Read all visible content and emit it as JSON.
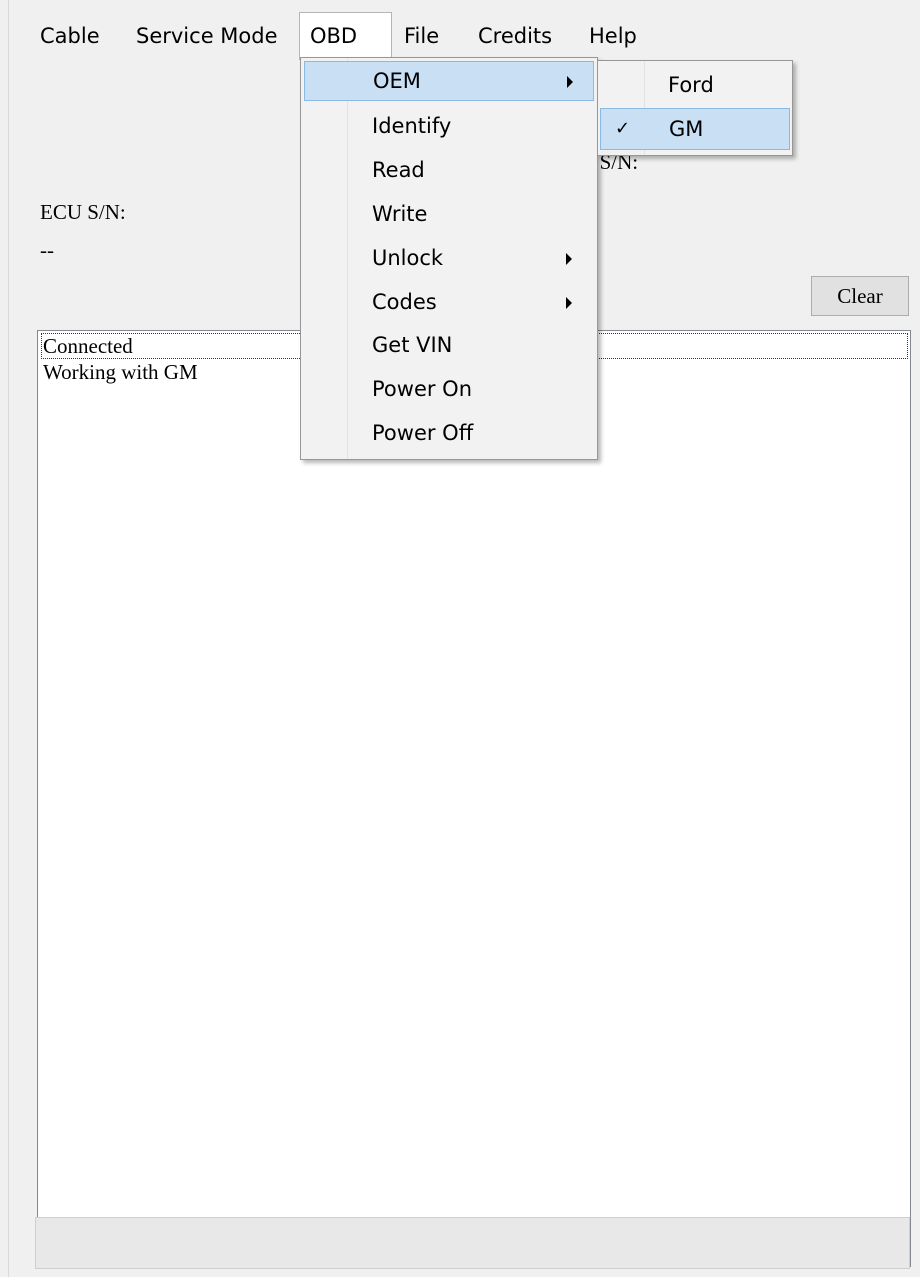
{
  "menubar": {
    "items": [
      "Cable",
      "Service Mode",
      "OBD",
      "File",
      "Credits",
      "Help"
    ]
  },
  "obd_menu": {
    "items": [
      {
        "label": "OEM",
        "submenu": true
      },
      {
        "label": "Identify"
      },
      {
        "label": "Read"
      },
      {
        "label": "Write"
      },
      {
        "label": "Unlock",
        "submenu": true
      },
      {
        "label": "Codes",
        "submenu": true
      },
      {
        "label": "Get VIN"
      },
      {
        "label": "Power On"
      },
      {
        "label": "Power Off"
      }
    ]
  },
  "oem_submenu": {
    "items": [
      {
        "label": "Ford",
        "checked": false
      },
      {
        "label": "GM",
        "checked": true
      }
    ],
    "check_glyph": "✓"
  },
  "main": {
    "partial_label": "e S/N:",
    "ecu_label": "ECU S/N:",
    "ecu_value": "--",
    "clear_button": "Clear",
    "log": [
      "Connected",
      "Working with GM"
    ]
  },
  "colors": {
    "highlight": "#c9dff4",
    "highlight_border": "#8cb8e4",
    "window_bg": "#f0f0f0"
  }
}
